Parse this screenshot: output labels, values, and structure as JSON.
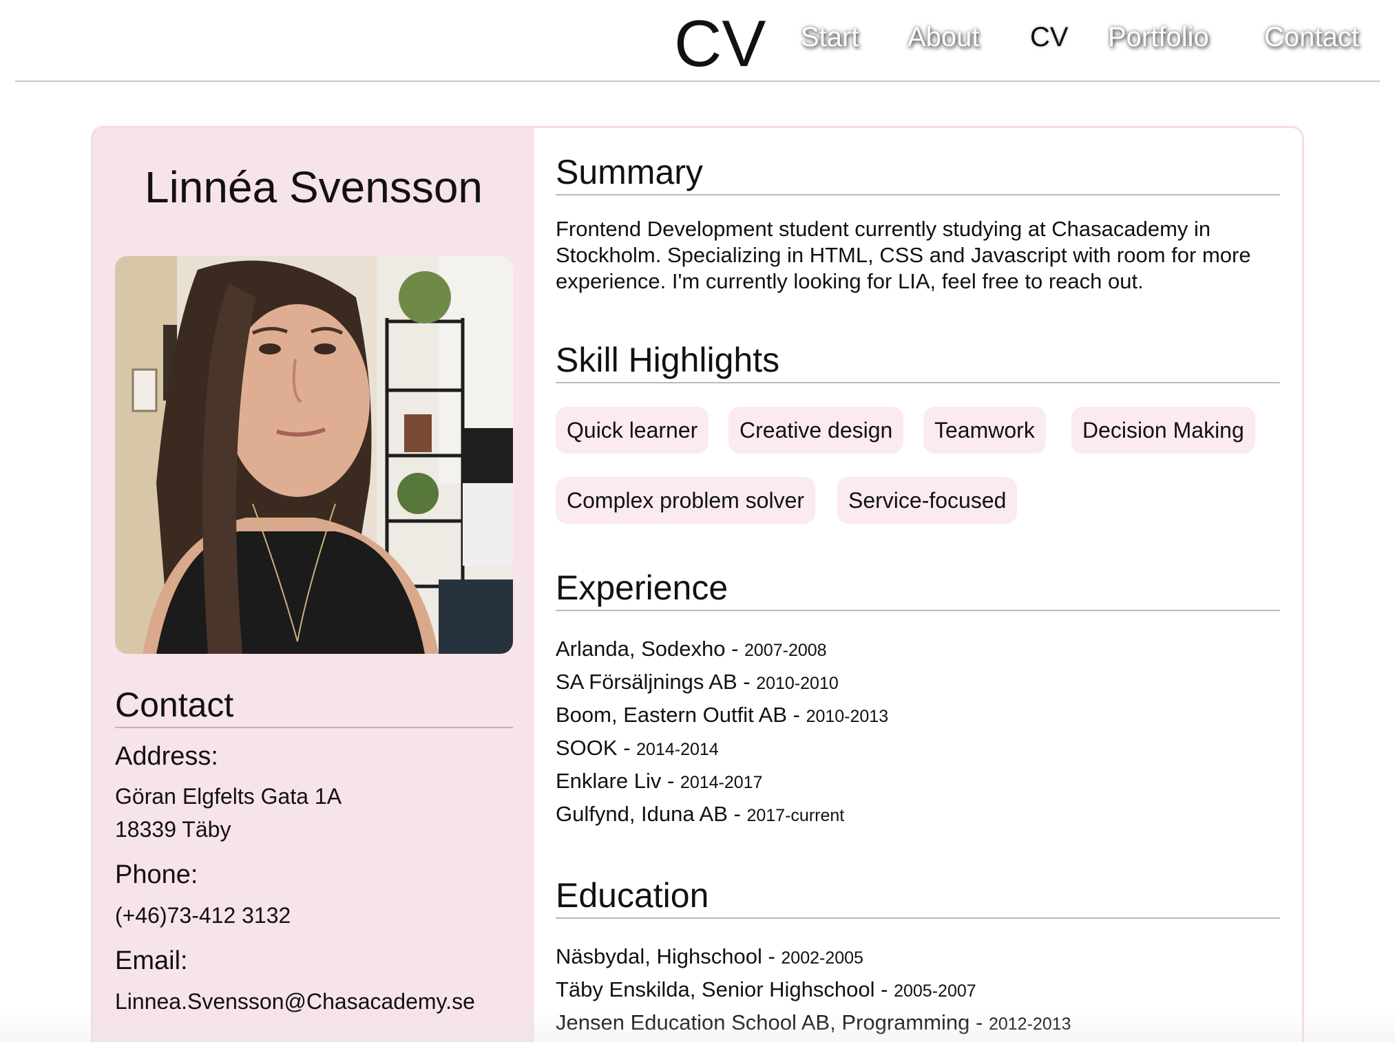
{
  "header": {
    "title": "CV",
    "nav": [
      {
        "label": "Start"
      },
      {
        "label": "About"
      },
      {
        "label": "CV",
        "active": true
      },
      {
        "label": "Portfolio"
      },
      {
        "label": "Contact"
      }
    ]
  },
  "sidebar": {
    "name": "Linnéa Svensson",
    "photo_alt": "profile-photo",
    "contact_heading": "Contact",
    "address_label": "Address:",
    "address_line1": "Göran Elgfelts Gata 1A",
    "address_line2": "18339 Täby",
    "phone_label": "Phone:",
    "phone": "(+46)73-412 3132",
    "email_label": "Email:",
    "email": "Linnea.Svensson@Chasacademy.se"
  },
  "main": {
    "summary_heading": "Summary",
    "summary_text": "Frontend Development student currently studying at Chasacademy in Stockholm. Specializing in HTML, CSS and Javascript with room for more experience. I'm currently looking for LIA, feel free to reach out.",
    "skills_heading": "Skill Highlights",
    "skills": [
      "Quick learner",
      "Creative design",
      "Teamwork",
      "Decision Making",
      "Complex problem solver",
      "Service-focused"
    ],
    "experience_heading": "Experience",
    "experience": [
      {
        "place": "Arlanda, Sodexho",
        "years": "2007-2008"
      },
      {
        "place": "SA Försäljnings AB",
        "years": "2010-2010"
      },
      {
        "place": "Boom, Eastern Outfit AB",
        "years": "2010-2013"
      },
      {
        "place": "SOOK",
        "years": "2014-2014"
      },
      {
        "place": "Enklare Liv",
        "years": "2014-2017"
      },
      {
        "place": "Gulfynd, Iduna AB",
        "years": "2017-current"
      }
    ],
    "education_heading": "Education",
    "education": [
      {
        "place": "Näsbydal, Highschool",
        "years": "2002-2005"
      },
      {
        "place": "Täby Enskilda, Senior Highschool",
        "years": "2005-2007"
      },
      {
        "place": "Jensen Education School AB, Programming",
        "years": "2012-2013"
      }
    ]
  },
  "colors": {
    "sidebar_bg": "#f7e3ea",
    "chip_bg": "#fbeaf0",
    "card_border": "#f6dbe4"
  }
}
